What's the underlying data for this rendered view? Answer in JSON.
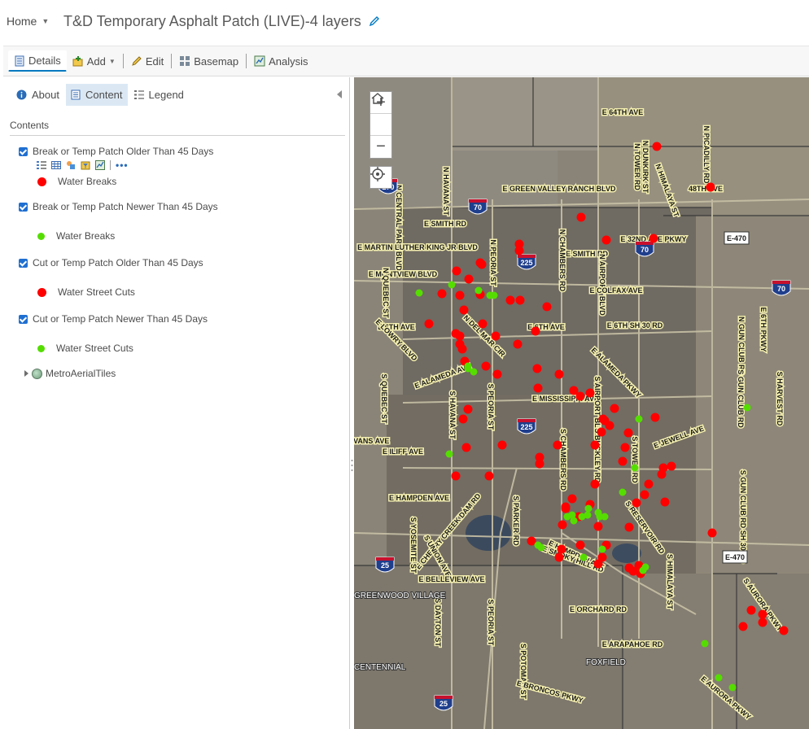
{
  "header": {
    "home_label": "Home",
    "map_title": "T&D Temporary Asphalt Patch (LIVE)-4 layers"
  },
  "toolbar": {
    "details_label": "Details",
    "add_label": "Add",
    "edit_label": "Edit",
    "basemap_label": "Basemap",
    "analysis_label": "Analysis"
  },
  "panel": {
    "tabs": [
      {
        "label": "About"
      },
      {
        "label": "Content"
      },
      {
        "label": "Legend"
      }
    ],
    "contents_label": "Contents",
    "layers": [
      {
        "name": "Break or Temp Patch Older Than 45 Days",
        "checked": true,
        "legend_label": "Water Breaks",
        "color": "#ff0000"
      },
      {
        "name": "Break or Temp Patch Newer Than 45 Days",
        "checked": true,
        "legend_label": "Water Breaks",
        "color": "#55dd00"
      },
      {
        "name": "Cut or Temp Patch Older Than 45 Days",
        "checked": true,
        "legend_label": "Water Street Cuts",
        "color": "#ff0000"
      },
      {
        "name": "Cut or Temp Patch Newer Than 45 Days",
        "checked": true,
        "legend_label": "Water Street Cuts",
        "color": "#55dd00"
      }
    ],
    "basemap_layer": "MetroAerialTiles"
  },
  "map": {
    "zoom_in": "+",
    "zoom_out": "−",
    "colors": {
      "old": "#ff0000",
      "new": "#55dd00",
      "label_halo": "#f4efb0"
    },
    "road_labels": [
      "E 64TH AVE",
      "N PICADILLY RD",
      "N TOWER RD",
      "N DUNKIRK ST",
      "N HIMALAYA ST",
      "E GREEN VALLEY RANCH BLVD",
      "48TH AVE",
      "E 32ND AVE PKWY",
      "E SMITH RD",
      "N HAVANA ST",
      "E SMITH RD",
      "N CENTRAL PARK BLVD",
      "E MARTIN LUTHER KING JR BLVD",
      "N PEORIA ST",
      "N CHAMBERS RD",
      "N AIRPORT BLVD",
      "E MONTVIEW BLVD",
      "E COLFAX AVE",
      "N QUEBEC ST",
      "E 6TH AVE",
      "E 6TH SH 30 RD",
      "E 6TH AVE",
      "E LOWRY BLVD",
      "N DEL MAR CIR",
      "E ALAMEDA AVE",
      "E ALAMEDA PKWY",
      "N GUN CLUB RD",
      "E 6TH PKWY",
      "S QUEBEC ST",
      "E MISSISSIPPI AVE",
      "S HAVANA ST",
      "S PEORIA ST",
      "S AIRPORT BLVD",
      "S GUN CLUB RD",
      "S HARVEST RD",
      "E JEWELL AVE",
      "E EVANS AVE",
      "E ILIFF AVE",
      "S CHAMBERS RD",
      "S BUCKLEY RD",
      "S TOWER RD",
      "E HAMPDEN AVE",
      "E CHERRY CREEK DAM RD",
      "S PARKER RD",
      "E HAMPDEN AVE",
      "S RESERVOIR RD",
      "S YOSEMITE ST",
      "S UNION AVE",
      "E SMOKY HILL RD",
      "S HIMALAYA ST",
      "S GUN CLUB RD SH 30 RD",
      "E BELLEVIEW AVE",
      "S DAYTON ST",
      "S PEORIA ST",
      "E ORCHARD RD",
      "S AURORA PKWY",
      "E ARAPAHOE RD",
      "S POTOMAC ST",
      "E BRONCOS PKWY",
      "E AURORA PKWY"
    ],
    "place_labels": [
      "GREENWOOD VILLAGE",
      "CENTENNIAL",
      "FOXFIELD"
    ],
    "highway_shields": [
      "270",
      "70",
      "225",
      "70",
      "E-470",
      "70",
      "225",
      "25",
      "E-470",
      "25"
    ]
  }
}
